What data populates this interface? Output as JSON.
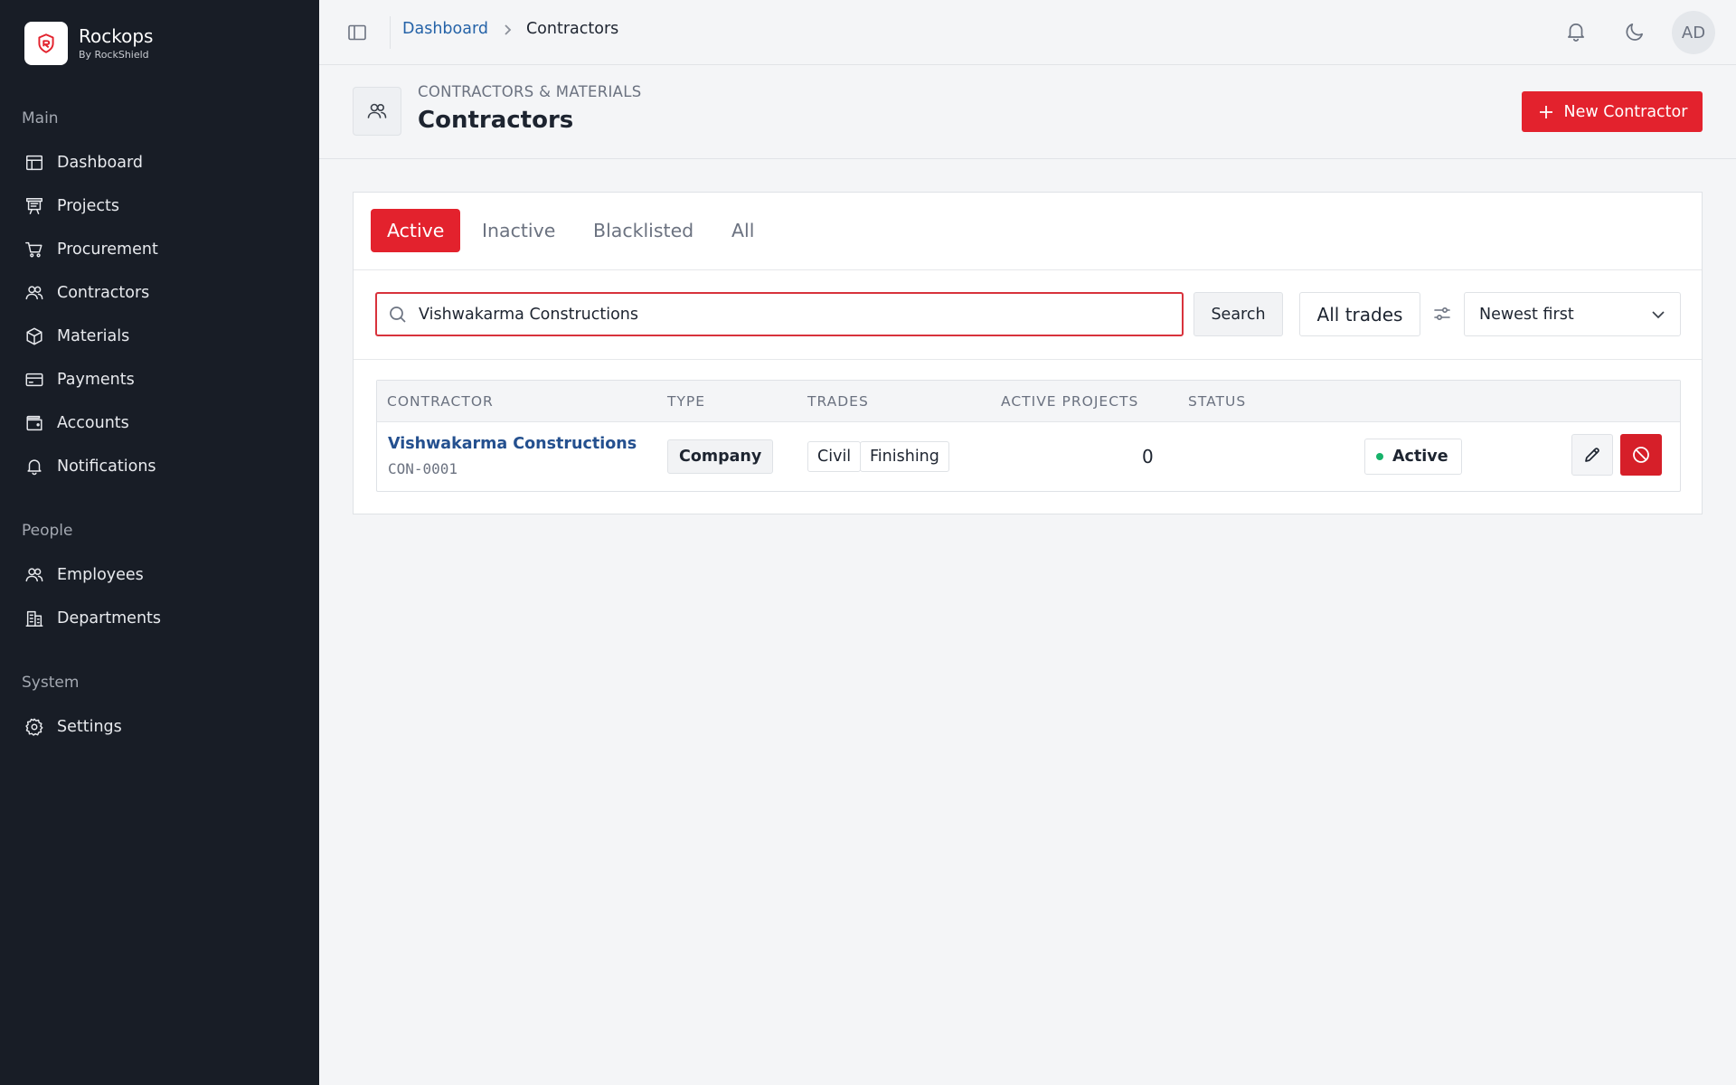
{
  "brand": {
    "name": "Rockops",
    "subtitle": "By RockShield"
  },
  "sidebar": {
    "sections": [
      {
        "label": "Main"
      },
      {
        "label": "People"
      },
      {
        "label": "System"
      }
    ],
    "items": [
      {
        "label": "Dashboard",
        "icon": "dashboard-icon"
      },
      {
        "label": "Projects",
        "icon": "projects-icon"
      },
      {
        "label": "Procurement",
        "icon": "cart-icon"
      },
      {
        "label": "Contractors",
        "icon": "users-icon"
      },
      {
        "label": "Materials",
        "icon": "box-icon"
      },
      {
        "label": "Payments",
        "icon": "credit-card-icon"
      },
      {
        "label": "Accounts",
        "icon": "wallet-icon"
      },
      {
        "label": "Notifications",
        "icon": "bell-icon"
      },
      {
        "label": "Employees",
        "icon": "users-icon"
      },
      {
        "label": "Departments",
        "icon": "building-icon"
      },
      {
        "label": "Settings",
        "icon": "gear-icon"
      }
    ]
  },
  "topbar": {
    "breadcrumb": {
      "parent": "Dashboard",
      "current": "Contractors"
    },
    "avatar_initials": "AD"
  },
  "header": {
    "eyebrow": "CONTRACTORS & MATERIALS",
    "title": "Contractors",
    "new_button": "New Contractor"
  },
  "tabs": [
    "Active",
    "Inactive",
    "Blacklisted",
    "All"
  ],
  "active_tab": "Active",
  "filters": {
    "search_value": "Vishwakarma Constructions",
    "search_button": "Search",
    "trades_select": "All trades",
    "sort_select": "Newest first"
  },
  "table": {
    "columns": [
      "CONTRACTOR",
      "TYPE",
      "TRADES",
      "ACTIVE PROJECTS",
      "STATUS"
    ],
    "rows": [
      {
        "name": "Vishwakarma Constructions",
        "code": "CON-0001",
        "type": "Company",
        "trades": [
          "Civil",
          "Finishing"
        ],
        "active_projects": "0",
        "status": "Active"
      }
    ]
  },
  "colors": {
    "accent": "#e3222d",
    "sidebar_bg": "#181d26",
    "link": "#2563a8",
    "status_active": "#17b26a"
  }
}
